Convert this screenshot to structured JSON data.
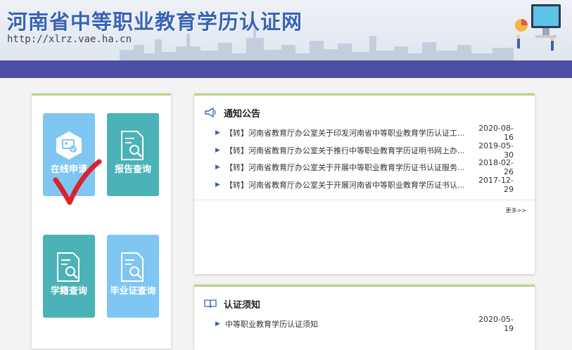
{
  "header": {
    "site_title": "河南省中等职业教育学历认证网",
    "site_url": "http://xlrz.vae.ha.cn"
  },
  "services": [
    {
      "label": "在线申请"
    },
    {
      "label": "报告查询"
    },
    {
      "label": "学籍查询"
    },
    {
      "label": "毕业证查询"
    }
  ],
  "notices": {
    "title": "通知公告",
    "more": "更多>>",
    "items": [
      {
        "title": "【转】河南省教育厅办公室关于印发河南省中等职业教育学历认证工...",
        "date": "2020-08-16"
      },
      {
        "title": "【转】河南省教育厅办公室关于推行中等职业教育学历证明书网上办...",
        "date": "2019-05-30"
      },
      {
        "title": "【转】河南省教育厅办公室关于开展中等职业教育学历证书认证服务...",
        "date": "2018-02-26"
      },
      {
        "title": "【转】河南省教育厅办公室关于开展河南省中等职业教育学历证书认...",
        "date": "2017-12-29"
      }
    ]
  },
  "guide": {
    "title": "认证须知",
    "items": [
      {
        "title": "中等职业教育学历认证须知",
        "date": "2020-05-19"
      }
    ]
  },
  "colors": {
    "nav_band": "#4d4ea3",
    "tile_light": "#7fc7f2",
    "tile_teal": "#4bb3b8",
    "title_blue": "#3a63b5",
    "check_red": "#d9232e",
    "panel_top": "#b9d38a"
  }
}
